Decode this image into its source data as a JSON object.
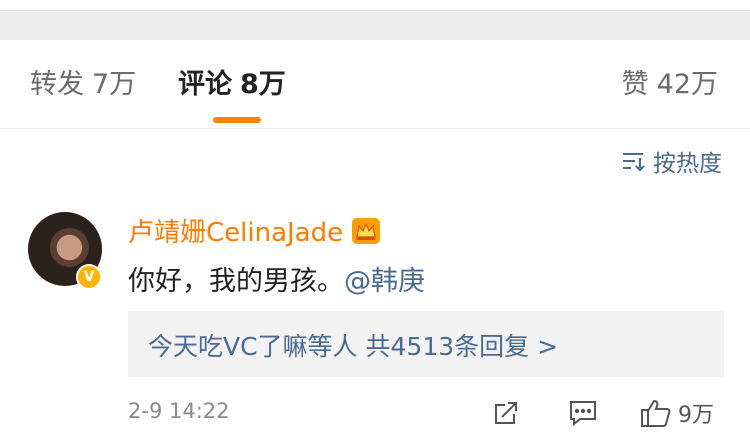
{
  "tabs": {
    "repost": {
      "label": "转发",
      "count": "7万"
    },
    "comment": {
      "label": "评论",
      "count": "8万"
    },
    "like": {
      "label": "赞",
      "count": "42万"
    }
  },
  "sort": {
    "label": "按热度"
  },
  "comment": {
    "username": "卢靖姗CelinaJade",
    "text": "你好，我的男孩。",
    "mention": "@韩庚",
    "replies_summary": "今天吃VC了嘛等人  共4513条回复 >",
    "time": "2-9 14:22",
    "like_count": "9万"
  },
  "colors": {
    "accent": "#ff8200",
    "link": "#4a6a92",
    "username": "#ff7b00"
  }
}
